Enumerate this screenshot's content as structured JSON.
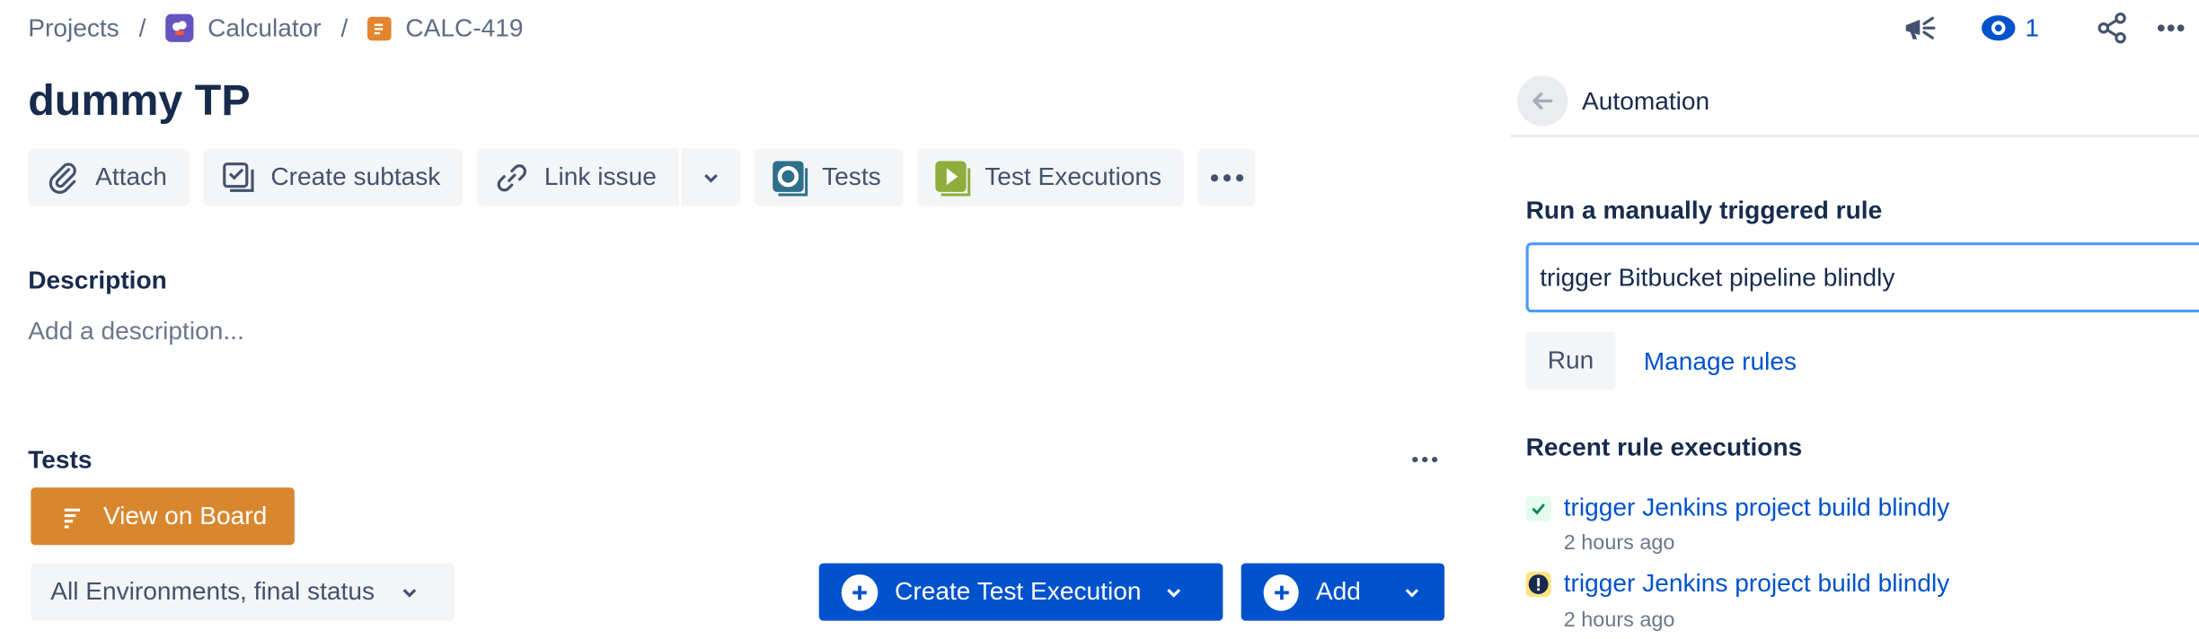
{
  "breadcrumbs": {
    "projects": "Projects",
    "separator": "/",
    "project": "Calculator",
    "issue_key": "CALC-419"
  },
  "header": {
    "watchers_count": "1"
  },
  "issue": {
    "title": "dummy TP"
  },
  "toolbar": {
    "attach": "Attach",
    "create_subtask": "Create subtask",
    "link_issue": "Link issue",
    "tests": "Tests",
    "test_executions": "Test Executions"
  },
  "description": {
    "heading": "Description",
    "placeholder": "Add a description..."
  },
  "tests_section": {
    "heading": "Tests",
    "view_on_board": "View on Board",
    "environment_filter": "All Environments, final status",
    "create_test_execution": "Create Test Execution",
    "add": "Add"
  },
  "automation": {
    "title": "Automation",
    "run_rule_label": "Run a manually triggered rule",
    "selected_rule": "trigger Bitbucket pipeline blindly",
    "run_button": "Run",
    "manage_rules": "Manage rules",
    "recent_label": "Recent rule executions",
    "executions": [
      {
        "name": "trigger Jenkins project build blindly",
        "time": "2 hours ago",
        "status": "success"
      },
      {
        "name": "trigger Jenkins project build blindly",
        "time": "2 hours ago",
        "status": "warning"
      }
    ]
  },
  "colors": {
    "primary": "#0052cc",
    "board_button": "#d9872f",
    "success": "#00875a",
    "warning_bg": "#ffe380",
    "focus_border": "#4c9aff"
  },
  "icons": {
    "project": "calculator-project-icon",
    "issue_type": "task-icon",
    "announce": "megaphone-icon",
    "watch": "eye-icon",
    "share": "share-icon",
    "more": "more-icon",
    "attach": "paperclip-icon",
    "subtask": "subtask-icon",
    "link": "link-icon",
    "tests": "xray-tests-icon",
    "test_executions": "xray-execution-icon",
    "back": "arrow-left-icon"
  }
}
